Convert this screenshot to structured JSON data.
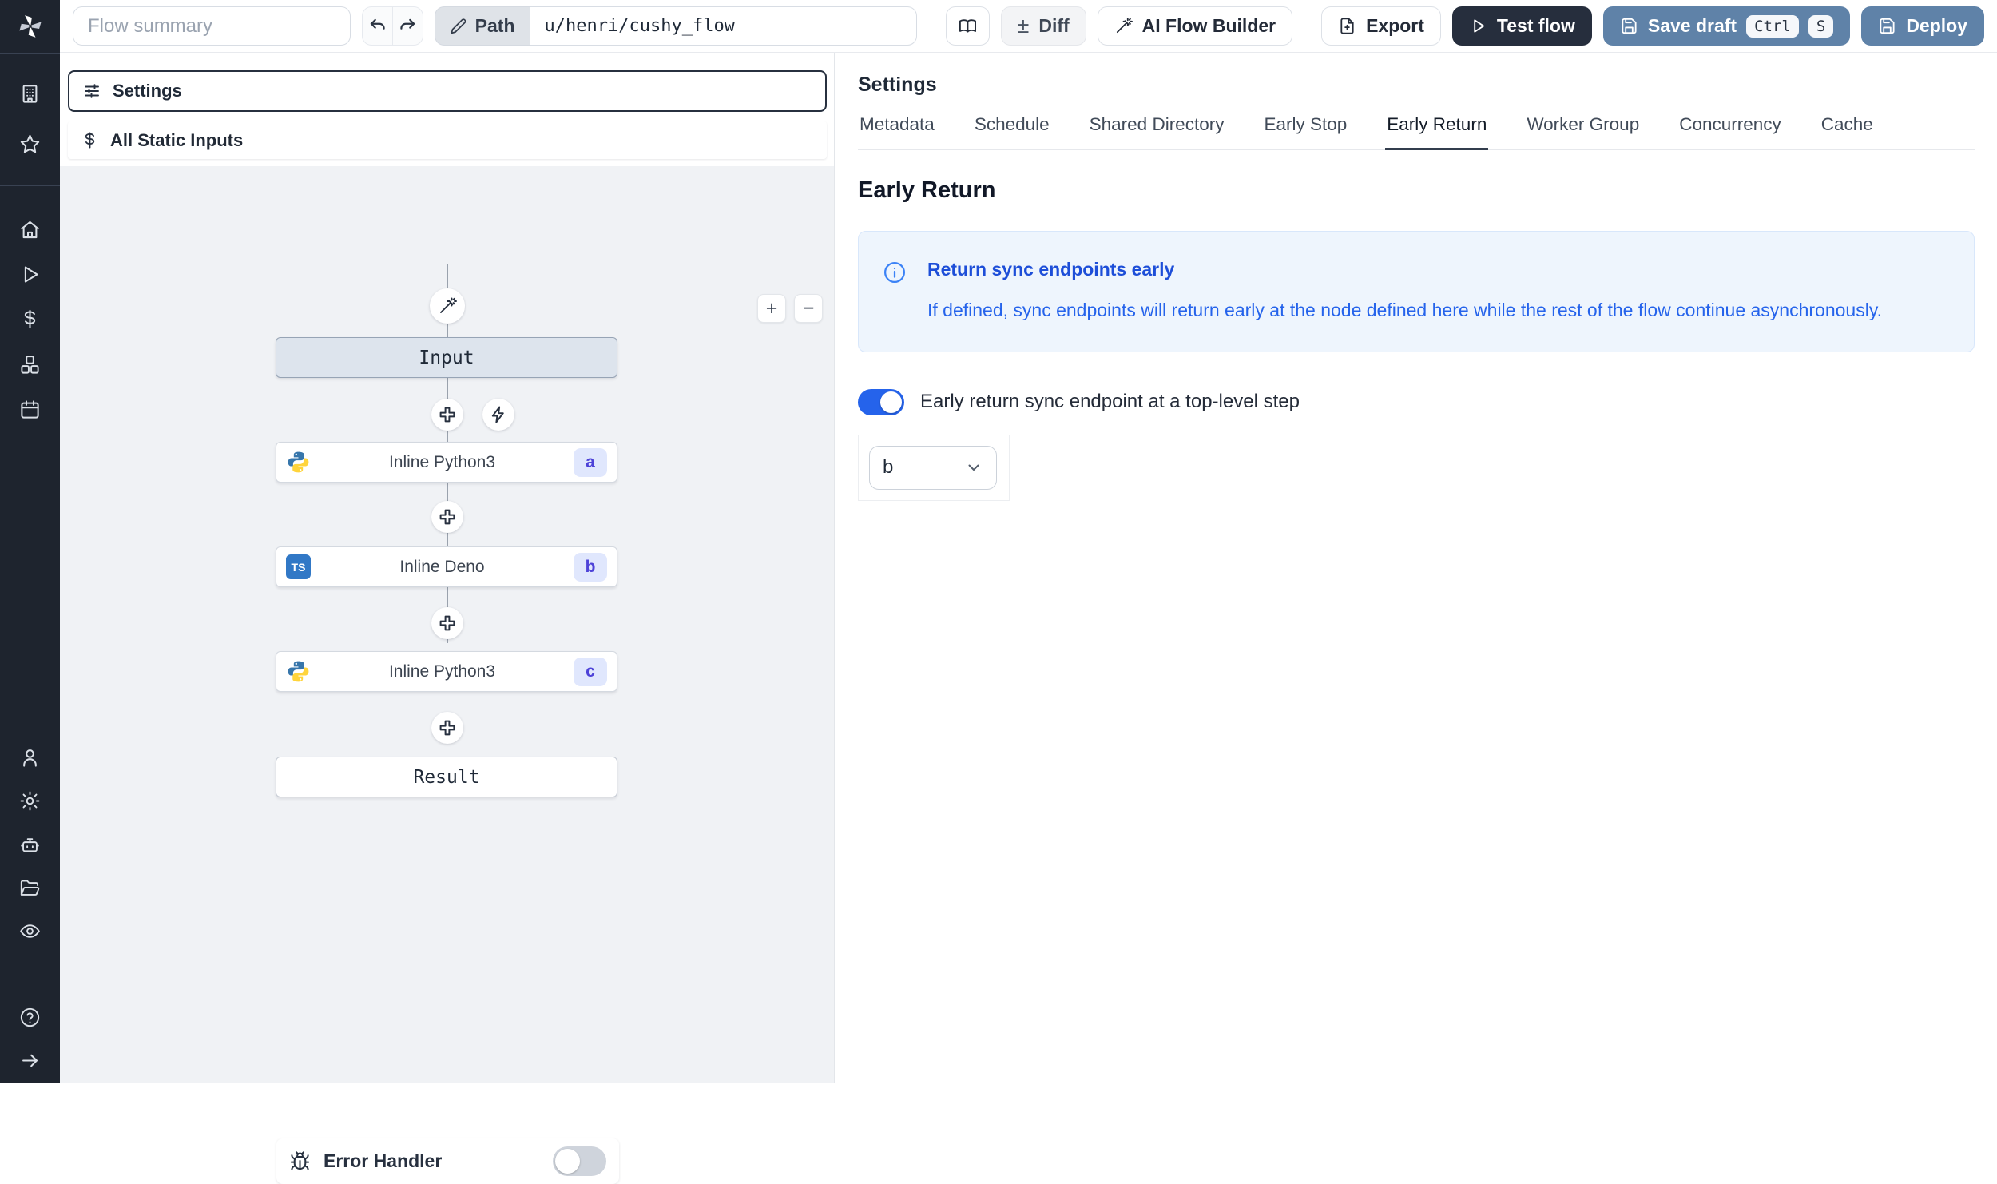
{
  "toolbar": {
    "flow_summary_placeholder": "Flow summary",
    "undo_icon": "undo-arrow",
    "redo_icon": "redo-arrow",
    "path_label": "Path",
    "path_value": "u/henri/cushy_flow",
    "diff_sign": "±",
    "diff_label": "Diff",
    "ai_flow_builder_label": "AI Flow Builder",
    "export_label": "Export",
    "test_flow_label": "Test flow",
    "save_draft_label": "Save draft",
    "save_draft_kbd": [
      "Ctrl",
      "S"
    ],
    "deploy_label": "Deploy"
  },
  "sidebar": {
    "icons": [
      "windmill-logo",
      "workspace-building",
      "favorites-star",
      "home",
      "runs-play",
      "variables-dollar",
      "resources-boxes",
      "schedules-calendar",
      "user",
      "settings-gear",
      "workers-robot",
      "folders",
      "audit-eye",
      "help-circle",
      "expand-arrow-right"
    ]
  },
  "flow_panel": {
    "settings_label": "Settings",
    "all_static_inputs_label": "All Static Inputs",
    "zoom_in": "+",
    "zoom_out": "−",
    "error_handler_label": "Error Handler",
    "error_handler_enabled": false,
    "nodes": [
      {
        "id": "input",
        "label": "Input",
        "kind": "input"
      },
      {
        "id": "a",
        "label": "Inline Python3",
        "lang": "python",
        "badge": "a"
      },
      {
        "id": "b",
        "label": "Inline Deno",
        "lang": "deno",
        "badge": "b",
        "lang_abbr": "TS"
      },
      {
        "id": "c",
        "label": "Inline Python3",
        "lang": "python",
        "badge": "c"
      },
      {
        "id": "result",
        "label": "Result",
        "kind": "result"
      }
    ]
  },
  "right_panel": {
    "title": "Settings",
    "tabs": [
      "Metadata",
      "Schedule",
      "Shared Directory",
      "Early Stop",
      "Early Return",
      "Worker Group",
      "Concurrency",
      "Cache"
    ],
    "active_tab": "Early Return",
    "section_title": "Early Return",
    "info": {
      "title": "Return sync endpoints early",
      "body": "If defined, sync endpoints will return early at the node defined here while the rest of the flow continue asynchronously."
    },
    "toggle_label": "Early return sync endpoint at a top-level step",
    "toggle_on": true,
    "select_value": "b"
  },
  "colors": {
    "sidebar_bg": "#1e242e",
    "accent_blue": "#2563eb",
    "steel_button": "#5f82a8",
    "dark_button": "#262e3d",
    "badge_bg": "#e0e7fd",
    "badge_text": "#4d42d8",
    "ts_blue": "#3178c6",
    "python_blue": "#3776ab",
    "python_yellow": "#ffd43b",
    "info_bg": "#eef5fd",
    "info_text": "#2563eb",
    "graph_bg": "#f0f2f5",
    "input_node_bg": "#dde4ed"
  }
}
